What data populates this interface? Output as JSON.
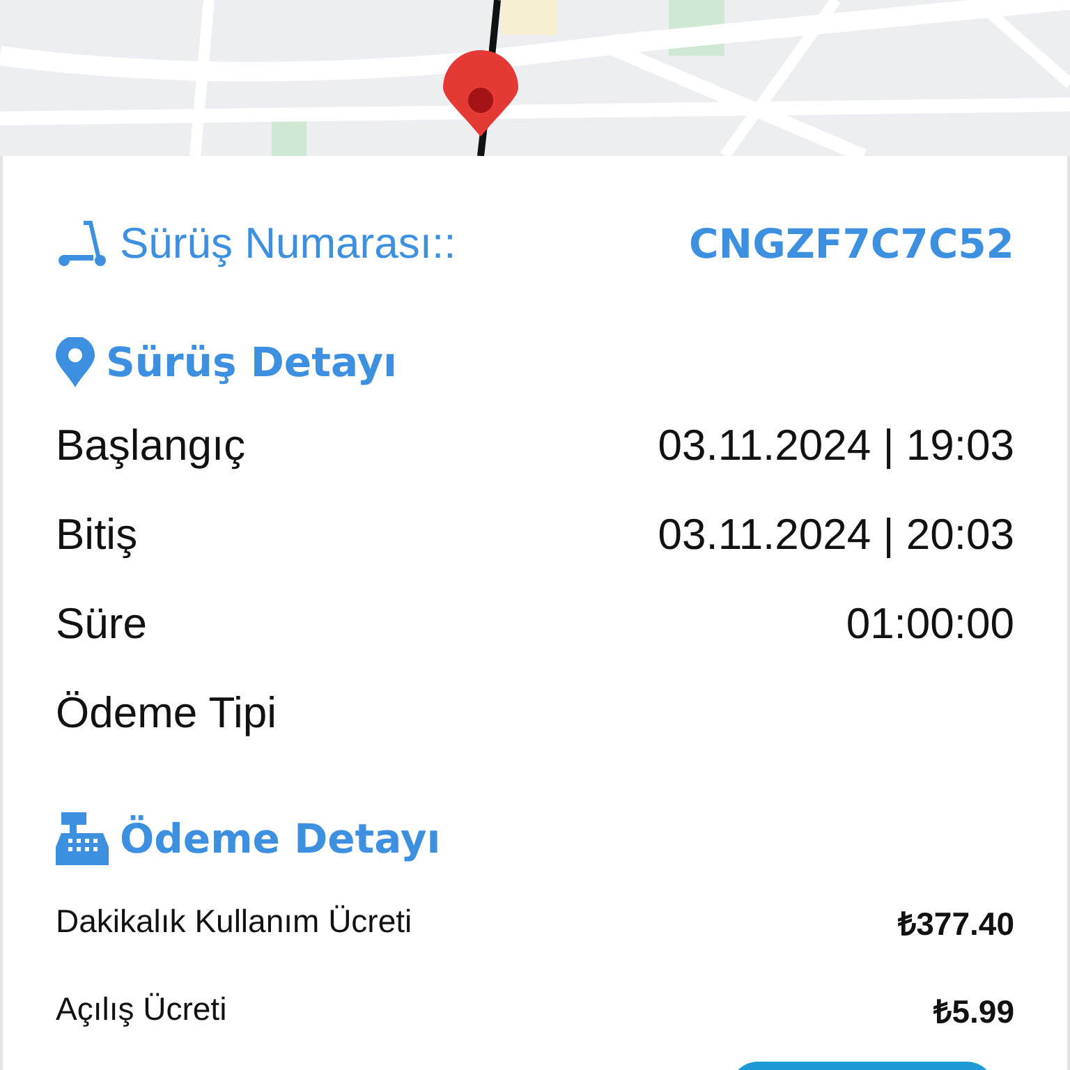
{
  "ride_number": {
    "label": "Sürüş Numarası::",
    "value": "CNGZF7C7C52"
  },
  "ride_details": {
    "title": "Sürüş Detayı",
    "rows": [
      {
        "label": "Başlangıç",
        "value": "03.11.2024 | 19:03"
      },
      {
        "label": "Bitiş",
        "value": "03.11.2024 | 20:03"
      },
      {
        "label": "Süre",
        "value": "01:00:00"
      },
      {
        "label": "Ödeme Tipi"
      }
    ]
  },
  "payment_details": {
    "title": "Ödeme Detayı",
    "rows": [
      {
        "label": "Dakikalık Kullanım Ücreti",
        "value": "₺377.40"
      },
      {
        "label": "Açılış Ücreti",
        "value": "₺5.99"
      }
    ]
  }
}
